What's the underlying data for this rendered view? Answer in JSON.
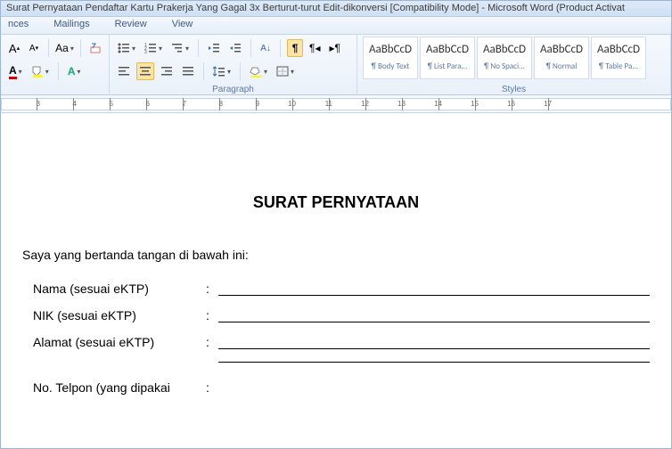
{
  "titlebar": "Surat Pernyataan Pendaftar Kartu Prakerja Yang Gagal 3x Berturut-turut Edit-dikonversi [Compatibility Mode]  -  Microsoft Word (Product Activat",
  "tabs": {
    "references": "nces",
    "mailings": "Mailings",
    "review": "Review",
    "view": "View"
  },
  "ribbon": {
    "paragraph_label": "Paragraph",
    "styles_label": "Styles",
    "font_grow": "A",
    "font_shrink": "A",
    "change_case": "Aa",
    "styles": [
      {
        "preview": "AaBbCcD",
        "name": "¶ Body Text"
      },
      {
        "preview": "AaBbCcD",
        "name": "¶ List Para..."
      },
      {
        "preview": "AaBbCcD",
        "name": "¶ No Spaci..."
      },
      {
        "preview": "AaBbCcD",
        "name": "¶ Normal"
      },
      {
        "preview": "AaBbCcD",
        "name": "¶ Table Pa..."
      }
    ]
  },
  "ruler": [
    "3",
    "4",
    "5",
    "6",
    "7",
    "8",
    "9",
    "10",
    "11",
    "12",
    "13",
    "14",
    "15",
    "16",
    "17"
  ],
  "doc": {
    "title": "SURAT PERNYATAAN",
    "intro": "Saya yang bertanda tangan di bawah ini:",
    "fields": {
      "nama": "Nama (sesuai eKTP)",
      "nik": "NIK (sesuai eKTP)",
      "alamat": "Alamat (sesuai eKTP)",
      "telpon": "No. Telpon (yang dipakai"
    },
    "colon": ":"
  }
}
